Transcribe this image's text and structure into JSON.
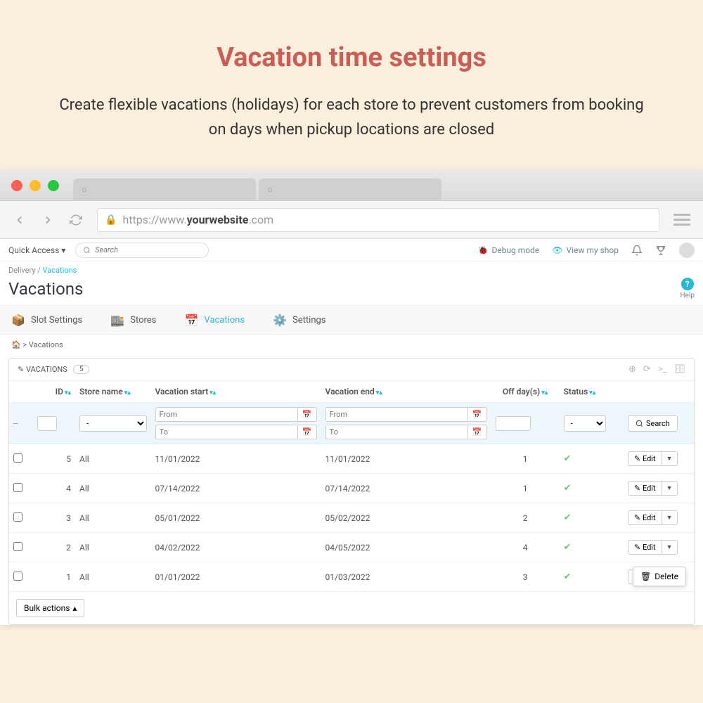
{
  "hero": {
    "title": "Vacation time settings",
    "subtitle": "Create flexible vacations (holidays) for each store to prevent customers from booking on days when pickup locations are closed"
  },
  "url": {
    "prefix": "https://www.",
    "bold": "yourwebsite",
    "suffix": ".com"
  },
  "topbar": {
    "quick_access": "Quick Access",
    "search_placeholder": "Search",
    "debug": "Debug mode",
    "view_shop": "View my shop"
  },
  "breadcrumb": {
    "parent": "Delivery",
    "current": "Vacations"
  },
  "page_title": "Vacations",
  "help_label": "Help",
  "tabs": {
    "slot": "Slot Settings",
    "stores": "Stores",
    "vacations": "Vacations",
    "settings": "Settings"
  },
  "sub_breadcrumb": "> Vacations",
  "panel": {
    "title": "VACATIONS",
    "count": "5"
  },
  "columns": {
    "id": "ID",
    "store": "Store name",
    "vstart": "Vacation start",
    "vend": "Vacation end",
    "off": "Off day(s)",
    "status": "Status"
  },
  "filters": {
    "from": "From",
    "to": "To",
    "dash": "-",
    "search": "Search"
  },
  "rows": [
    {
      "id": "5",
      "store": "All",
      "vstart": "11/01/2022",
      "vend": "11/01/2022",
      "off": "1"
    },
    {
      "id": "4",
      "store": "All",
      "vstart": "07/14/2022",
      "vend": "07/14/2022",
      "off": "1"
    },
    {
      "id": "3",
      "store": "All",
      "vstart": "05/01/2022",
      "vend": "05/02/2022",
      "off": "2"
    },
    {
      "id": "2",
      "store": "All",
      "vstart": "04/02/2022",
      "vend": "04/05/2022",
      "off": "4"
    },
    {
      "id": "1",
      "store": "All",
      "vstart": "01/01/2022",
      "vend": "01/03/2022",
      "off": "3"
    }
  ],
  "actions": {
    "edit": "Edit",
    "delete": "Delete",
    "bulk": "Bulk actions"
  }
}
